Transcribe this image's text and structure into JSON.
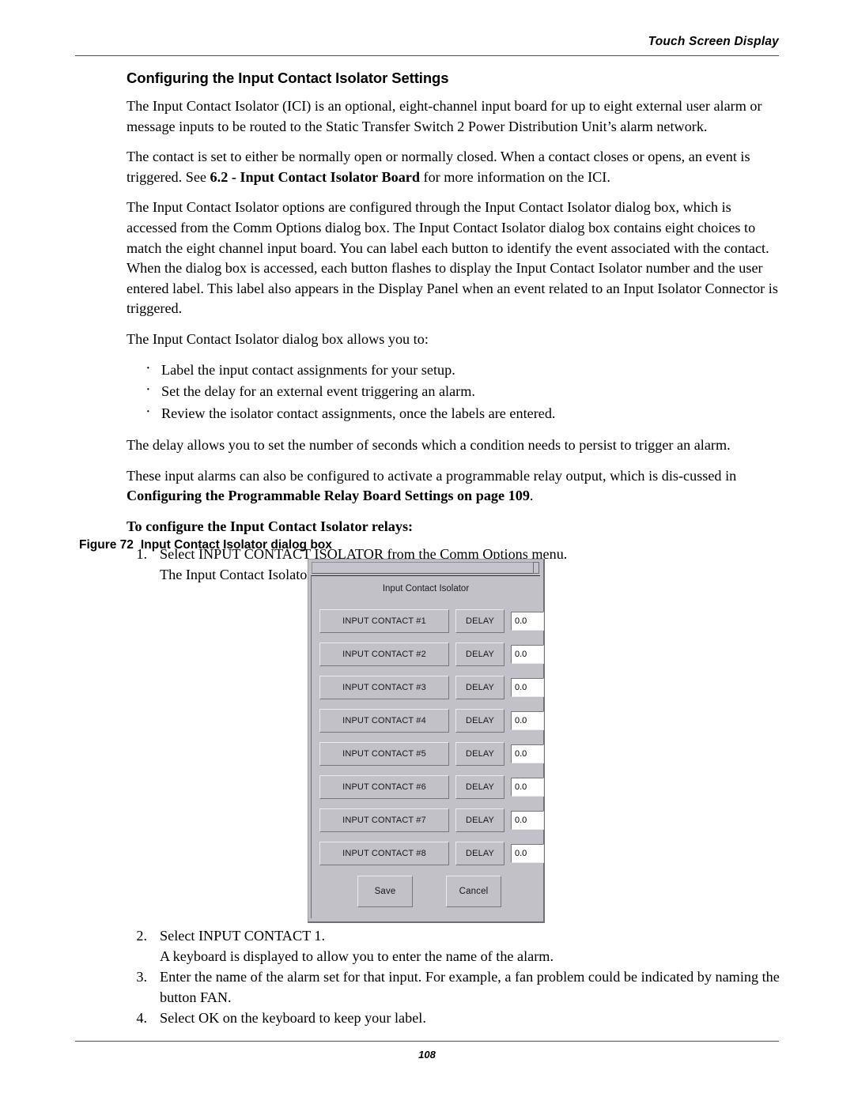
{
  "header": {
    "title": "Touch Screen Display"
  },
  "footer": {
    "page_number": "108"
  },
  "section": {
    "title": "Configuring the Input Contact Isolator Settings"
  },
  "paragraphs": {
    "p1": "The Input Contact Isolator (ICI) is an optional, eight-channel input board for up to eight external user alarm or message inputs to be routed to the Static Transfer Switch 2 Power Distribution Unit’s alarm network.",
    "p2_part1": "The contact is set to either be normally open or normally closed. When a contact closes or opens, an event is triggered. See ",
    "p2_bold": "6.2 - Input Contact Isolator Board",
    "p2_part2": " for more information on the ICI.",
    "p3": "The Input Contact Isolator options are configured through the Input Contact Isolator dialog box, which is accessed from the Comm Options dialog box. The Input Contact Isolator dialog box contains eight choices to match the eight channel input board. You can label each button to identify the event associated with the contact. When the dialog box is accessed, each button flashes to display the Input Contact Isolator number and the user entered label. This label also appears in the Display Panel when an event related to an Input Isolator Connector is triggered.",
    "p4": "The Input Contact Isolator dialog box allows you to:",
    "p5": "The delay allows you to set the number of seconds which a condition needs to persist to trigger an alarm.",
    "p6_part1": "These input alarms can also be configured to activate a programmable relay output, which is dis-cussed in ",
    "p6_bold": "Configuring the Programmable Relay Board Settings on page 109",
    "p6_part2": "."
  },
  "bullets": [
    "Label the input contact assignments for your setup.",
    "Set the delay for an external event triggering an alarm.",
    "Review the isolator contact assignments, once the labels are entered."
  ],
  "runin_heading": "To configure the Input Contact Isolator relays:",
  "steps_before_figure": [
    {
      "num": "1.",
      "text": "Select INPUT CONTACT ISOLATOR from the Comm Options menu.",
      "sub": "The Input Contact Isolator dialog box is displayed."
    }
  ],
  "steps_after_figure": [
    {
      "num": "2.",
      "text": "Select INPUT CONTACT 1.",
      "sub": "A keyboard is displayed to allow you to enter the name of the alarm."
    },
    {
      "num": "3.",
      "text": "Enter the name of the alarm set for that input. For example, a fan problem could be indicated by naming the button FAN.",
      "sub": ""
    },
    {
      "num": "4.",
      "text": "Select OK on the keyboard to keep your label.",
      "sub": ""
    }
  ],
  "figure": {
    "number": "Figure 72",
    "caption": "Input Contact Isolator dialog box"
  },
  "dialog": {
    "title": "Input Contact Isolator",
    "delay_button_label": "DELAY",
    "rows": [
      {
        "contact": "INPUT CONTACT #1",
        "delay": "0.0"
      },
      {
        "contact": "INPUT CONTACT #2",
        "delay": "0.0"
      },
      {
        "contact": "INPUT CONTACT #3",
        "delay": "0.0"
      },
      {
        "contact": "INPUT CONTACT #4",
        "delay": "0.0"
      },
      {
        "contact": "INPUT CONTACT #5",
        "delay": "0.0"
      },
      {
        "contact": "INPUT CONTACT #6",
        "delay": "0.0"
      },
      {
        "contact": "INPUT CONTACT #7",
        "delay": "0.0"
      },
      {
        "contact": "INPUT CONTACT #8",
        "delay": "0.0"
      }
    ],
    "save_label": "Save",
    "cancel_label": "Cancel",
    "colors": {
      "face": "#c3c1c8",
      "field": "#ffffff",
      "shadow": "#77757d",
      "highlight": "#eceaf0"
    }
  }
}
